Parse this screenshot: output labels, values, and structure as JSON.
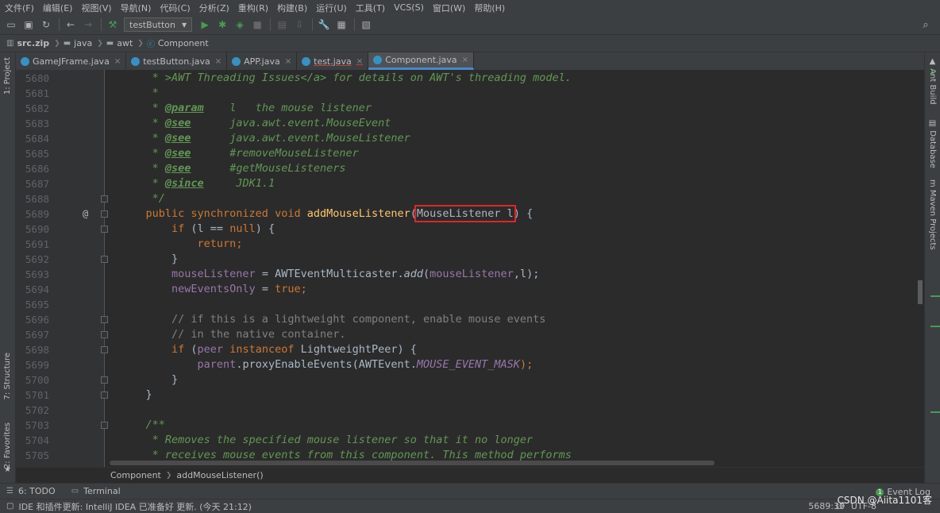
{
  "menu": [
    "文件(F)",
    "编辑(E)",
    "视图(V)",
    "导航(N)",
    "代码(C)",
    "分析(Z)",
    "重构(R)",
    "构建(B)",
    "运行(U)",
    "工具(T)",
    "VCS(S)",
    "窗口(W)",
    "帮助(H)"
  ],
  "toolbar": {
    "run_config": "testButton"
  },
  "breadcrumb": [
    "src.zip",
    "java",
    "awt",
    "Component"
  ],
  "tabs": [
    {
      "label": "GameJFrame.java",
      "active": false
    },
    {
      "label": "testButton.java",
      "active": false
    },
    {
      "label": "APP.java",
      "active": false
    },
    {
      "label": "test.java",
      "active": false
    },
    {
      "label": "Component.java",
      "active": true
    }
  ],
  "left_tools": [
    "1: Project",
    "7: Structure",
    "2: Favorites"
  ],
  "right_tools": [
    "Ant Build",
    "Database",
    "Maven Projects"
  ],
  "editor": {
    "line_numbers": [
      "5680",
      "5681",
      "5682",
      "5683",
      "5684",
      "5685",
      "5686",
      "5687",
      "5688",
      "5689",
      "5690",
      "5691",
      "5692",
      "5693",
      "5694",
      "5695",
      "5696",
      "5697",
      "5698",
      "5699",
      "5700",
      "5701",
      "5702",
      "5703",
      "5704",
      "5705"
    ],
    "gutter_marker": "@",
    "code": {
      "l5680": "     * >AWT Threading Issues</a> for details on AWT's threading model.",
      "l5681": "     *",
      "l5682_a": "     * ",
      "l5682_tag": "@param",
      "l5682_b": "    l   the mouse listener",
      "l5683_a": "     * ",
      "l5683_tag": "@see",
      "l5683_b": "      java.awt.event.MouseEvent",
      "l5684_a": "     * ",
      "l5684_tag": "@see",
      "l5684_b": "      java.awt.event.MouseListener",
      "l5685_a": "     * ",
      "l5685_tag": "@see",
      "l5685_b": "      #removeMouseListener",
      "l5686_a": "     * ",
      "l5686_tag": "@see",
      "l5686_b": "      #getMouseListeners",
      "l5687_a": "     * ",
      "l5687_tag": "@since",
      "l5687_b": "     JDK1.1",
      "l5688": "     */",
      "l5689_kw": "    public synchronized void ",
      "l5689_fn": "addMouseListener",
      "l5689_p1": "(",
      "l5689_param": "MouseListener l",
      "l5689_p2": ") {",
      "l5690_kw": "        if",
      "l5690_a": " (l == ",
      "l5690_null": "null",
      "l5690_b": ") {",
      "l5691_kw": "            return",
      "l5691_b": ";",
      "l5692": "        }",
      "l5693_f": "        mouseListener",
      "l5693_a": " = AWTEventMulticaster.",
      "l5693_m": "add",
      "l5693_b": "(",
      "l5693_f2": "mouseListener",
      "l5693_c": ",l);",
      "l5694_f": "        newEventsOnly",
      "l5694_a": " = ",
      "l5694_kw": "true",
      "l5694_b": ";",
      "l5696": "        // if this is a lightweight component, enable mouse events",
      "l5697": "        // in the native container.",
      "l5698_kw": "        if",
      "l5698_a": " (",
      "l5698_f": "peer",
      "l5698_kw2": " instanceof",
      "l5698_b": " LightweightPeer) {",
      "l5699_f": "            parent",
      "l5699_a": ".proxyEnableEvents(AWTEvent.",
      "l5699_st": "MOUSE_EVENT_MASK",
      "l5699_b": ");",
      "l5700": "        }",
      "l5701": "    }",
      "l5703": "    /**",
      "l5704": "     * Removes the specified mouse listener so that it no longer",
      "l5705": "     * receives mouse events from this component. This method performs"
    }
  },
  "structure_breadcrumb": [
    "Component",
    "addMouseListener()"
  ],
  "tool_windows": [
    "6: TODO",
    "Terminal"
  ],
  "event_log": "Event Log",
  "status": {
    "message": "IDE 和插件更新: IntelliJ IDEA 已准备好 更新. (今天 21:12)",
    "position": "5689:30",
    "line_sep": "LF",
    "encoding": "UTF-8"
  },
  "watermark": "CSDN @Aiita1101客"
}
